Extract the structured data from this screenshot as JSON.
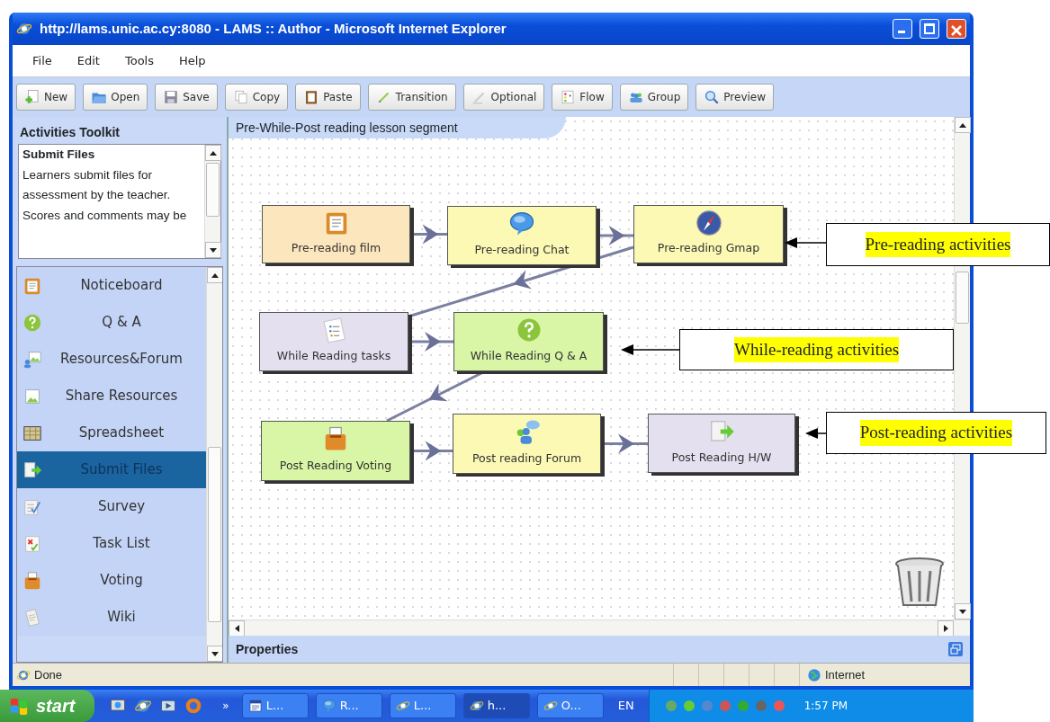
{
  "window": {
    "title": "http://lams.unic.ac.cy:8080 - LAMS :: Author - Microsoft Internet Explorer"
  },
  "menu": [
    "File",
    "Edit",
    "Tools",
    "Help"
  ],
  "toolbar": [
    {
      "label": "New",
      "kind": "new"
    },
    {
      "label": "Open",
      "kind": "open"
    },
    {
      "label": "Save",
      "kind": "save"
    },
    {
      "label": "Copy",
      "kind": "copy"
    },
    {
      "label": "Paste",
      "kind": "paste"
    },
    {
      "label": "Transition",
      "kind": "transition"
    },
    {
      "label": "Optional",
      "kind": "optional"
    },
    {
      "label": "Flow",
      "kind": "flow"
    },
    {
      "label": "Group",
      "kind": "group"
    },
    {
      "label": "Preview",
      "kind": "preview"
    }
  ],
  "toolkit": {
    "title": "Activities Toolkit",
    "description": {
      "heading": "Submit Files",
      "text": "Learners submit files for assessment by the teacher. Scores and comments may be"
    },
    "items": [
      {
        "label": "Noticeboard",
        "kind": "notice",
        "selected": false
      },
      {
        "label": "Q & A",
        "kind": "qa",
        "selected": false
      },
      {
        "label": "Resources&Forum",
        "kind": "resources",
        "selected": false
      },
      {
        "label": "Share Resources",
        "kind": "share",
        "selected": false
      },
      {
        "label": "Spreadsheet",
        "kind": "spreadsheet",
        "selected": false
      },
      {
        "label": "Submit Files",
        "kind": "submit",
        "selected": true
      },
      {
        "label": "Survey",
        "kind": "survey",
        "selected": false
      },
      {
        "label": "Task List",
        "kind": "tasklist",
        "selected": false
      },
      {
        "label": "Voting",
        "kind": "voting",
        "selected": false
      },
      {
        "label": "Wiki",
        "kind": "wiki",
        "selected": false
      }
    ]
  },
  "canvas": {
    "title": "Pre-While-Post reading lesson segment",
    "activities": [
      {
        "label": "Pre-reading film",
        "kind": "notice",
        "color": "#fce6bd"
      },
      {
        "label": "Pre-reading Chat",
        "kind": "chat",
        "color": "#fcf9b5"
      },
      {
        "label": "Pre-reading Gmap",
        "kind": "map",
        "color": "#fcf9b5"
      },
      {
        "label": "While Reading tasks",
        "kind": "tasks",
        "color": "#e4e0f0"
      },
      {
        "label": "While Reading Q & A",
        "kind": "qa",
        "color": "#d9f5a6"
      },
      {
        "label": "Post Reading Voting",
        "kind": "voting",
        "color": "#d9f5a6"
      },
      {
        "label": "Post reading Forum",
        "kind": "forum",
        "color": "#fcf9b5"
      },
      {
        "label": "Post Reading H/W",
        "kind": "submit",
        "color": "#e4e0f0"
      }
    ]
  },
  "properties": {
    "title": "Properties"
  },
  "status_bar": {
    "text": "Done",
    "zone": "Internet"
  },
  "taskbar": {
    "start": "start",
    "overflow": "»",
    "buttons": [
      {
        "label": "L...",
        "kind": "word",
        "selected": false
      },
      {
        "label": "R...",
        "kind": "chat",
        "selected": false
      },
      {
        "label": "L...",
        "kind": "browser",
        "selected": false
      },
      {
        "label": "h...",
        "kind": "browser",
        "selected": true
      },
      {
        "label": "O...",
        "kind": "browser",
        "selected": false
      }
    ],
    "language": "EN",
    "clock": "1:57 PM"
  },
  "annotations": [
    {
      "text": "Pre-reading activities"
    },
    {
      "text": "While-reading activities"
    },
    {
      "text": "Post-reading activities"
    }
  ]
}
